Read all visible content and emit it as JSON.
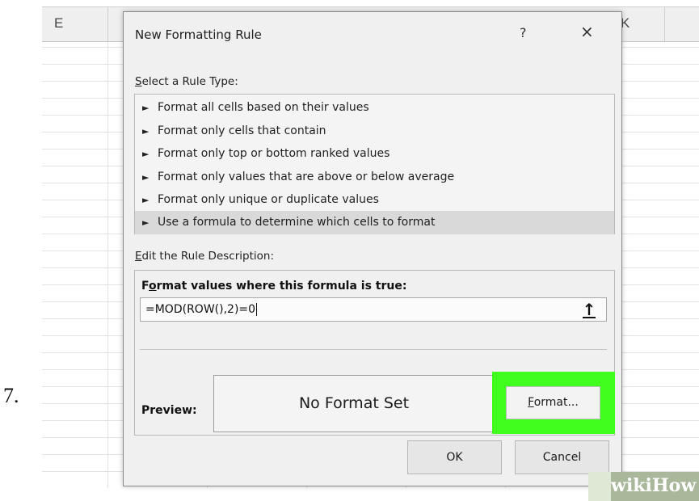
{
  "step_number": "7.",
  "spreadsheet": {
    "columns": [
      "E",
      "K"
    ]
  },
  "dialog": {
    "title": "New Formatting Rule",
    "help_glyph": "?",
    "close_glyph": "×",
    "select_rule_type_label": {
      "mnemonic": "S",
      "rest": "elect a Rule Type:"
    },
    "rule_types": [
      "Format all cells based on their values",
      "Format only cells that contain",
      "Format only top or bottom ranked values",
      "Format only values that are above or below average",
      "Format only unique or duplicate values",
      "Use a formula to determine which cells to format"
    ],
    "selected_rule_index": 5,
    "edit_description_label": {
      "mnemonic": "E",
      "rest": "dit the Rule Description:"
    },
    "formula_heading": {
      "pre": "F",
      "mnemonic": "o",
      "rest": "rmat values where this formula is true:"
    },
    "formula_value": "=MOD(ROW(),2)=0",
    "collapse_glyph": "↑",
    "preview_label": "Preview:",
    "preview_text": "No Format Set",
    "format_button": {
      "mnemonic": "F",
      "rest": "ormat..."
    },
    "ok_label": "OK",
    "cancel_label": "Cancel"
  },
  "highlight_color": "#40ff1e",
  "watermark": "wikiHow"
}
